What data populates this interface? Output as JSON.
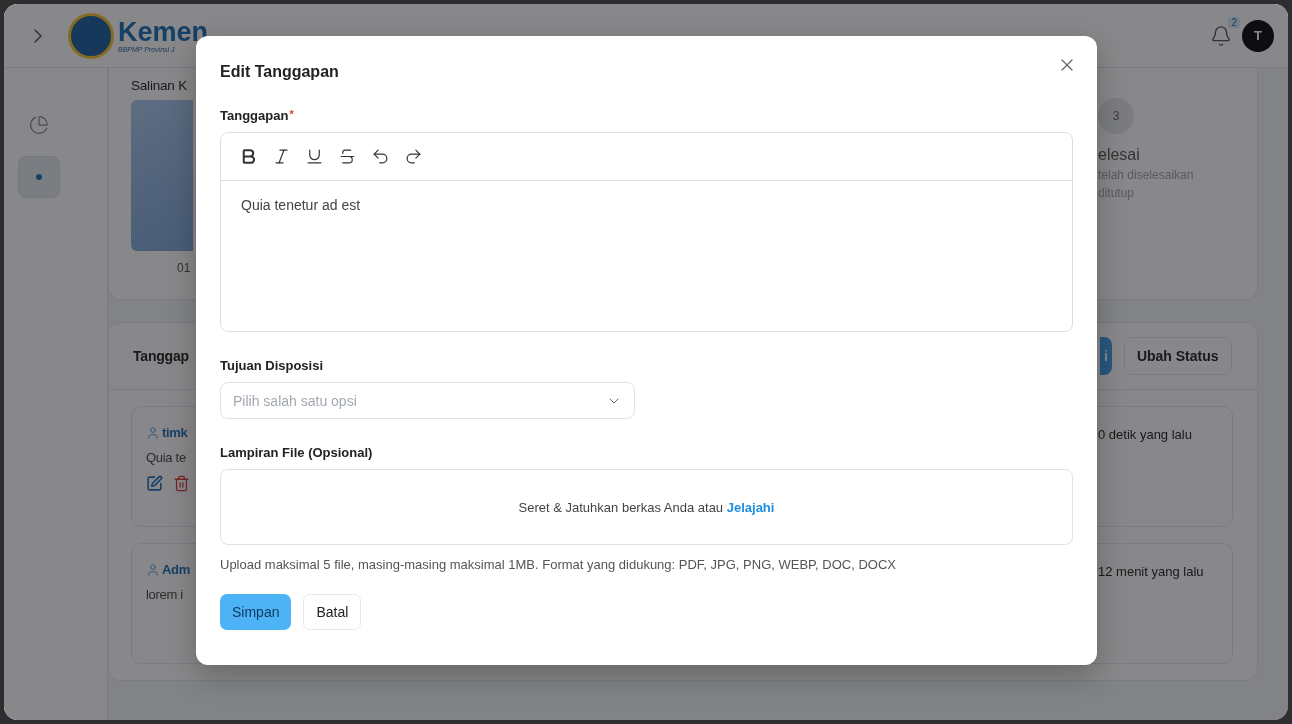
{
  "header": {
    "logo_text": "Kemen",
    "logo_subtitle": "BBPMP Provinsi J",
    "notification_count": "2",
    "avatar_initial": "T"
  },
  "sidebar": {
    "items": [
      {
        "kind": "chart",
        "selected": false
      },
      {
        "kind": "dot",
        "selected": true
      }
    ]
  },
  "document_card": {
    "title": "Salinan K",
    "caption": "01",
    "step": {
      "number": "3",
      "title": "elesai",
      "description_lines": [
        "telah diselesaikan",
        "ditutup"
      ]
    }
  },
  "responses_card": {
    "title": "Tanggap",
    "buttons": [
      {
        "label": "i",
        "kind": "primary"
      },
      {
        "label": "Ubah Status",
        "kind": "secondary"
      }
    ],
    "comments": [
      {
        "author": "timk",
        "text": "Quia te",
        "time": "0 detik yang lalu",
        "has_actions": true
      },
      {
        "author": "Adm",
        "text": "lorem i",
        "time": "12 menit yang lalu",
        "has_actions": false
      }
    ]
  },
  "modal": {
    "title": "Edit Tanggapan",
    "response_field": {
      "label": "Tanggapan",
      "required_mark": "*",
      "value": "Quia tenetur ad est"
    },
    "disposition_field": {
      "label": "Tujuan Disposisi",
      "placeholder": "Pilih salah satu opsi"
    },
    "attachment_field": {
      "label": "Lampiran File (Opsional)",
      "drop_text": "Seret & Jatuhkan berkas Anda atau",
      "browse_link": "Jelajahi",
      "hint": "Upload maksimal 5 file, masing-masing maksimal 1MB. Format yang didukung: PDF, JPG, PNG, WEBP, DOC, DOCX"
    },
    "buttons": [
      {
        "label": "Simpan",
        "kind": "primary"
      },
      {
        "label": "Batal",
        "kind": "secondary"
      }
    ]
  }
}
